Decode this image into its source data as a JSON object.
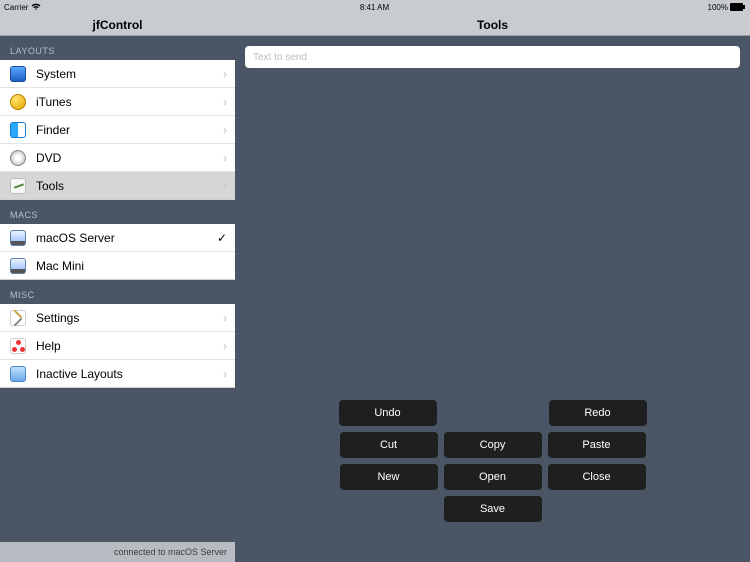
{
  "status": {
    "carrier": "Carrier",
    "time": "8:41 AM",
    "battery": "100%"
  },
  "header": {
    "left_title": "jfControl",
    "right_title": "Tools"
  },
  "sections": {
    "layouts": {
      "title": "LAYOUTS",
      "items": [
        {
          "label": "System",
          "selected": false
        },
        {
          "label": "iTunes",
          "selected": false
        },
        {
          "label": "Finder",
          "selected": false
        },
        {
          "label": "DVD",
          "selected": false
        },
        {
          "label": "Tools",
          "selected": true
        }
      ]
    },
    "macs": {
      "title": "MACS",
      "items": [
        {
          "label": "macOS Server",
          "checked": true
        },
        {
          "label": "Mac Mini",
          "checked": false
        }
      ]
    },
    "misc": {
      "title": "MISC",
      "items": [
        {
          "label": "Settings"
        },
        {
          "label": "Help"
        },
        {
          "label": "Inactive Layouts"
        }
      ]
    }
  },
  "footer_status": "connected to macOS Server",
  "main": {
    "text_placeholder": "Text to send",
    "buttons": {
      "undo": "Undo",
      "redo": "Redo",
      "cut": "Cut",
      "copy": "Copy",
      "paste": "Paste",
      "new": "New",
      "open": "Open",
      "close": "Close",
      "save": "Save"
    }
  }
}
